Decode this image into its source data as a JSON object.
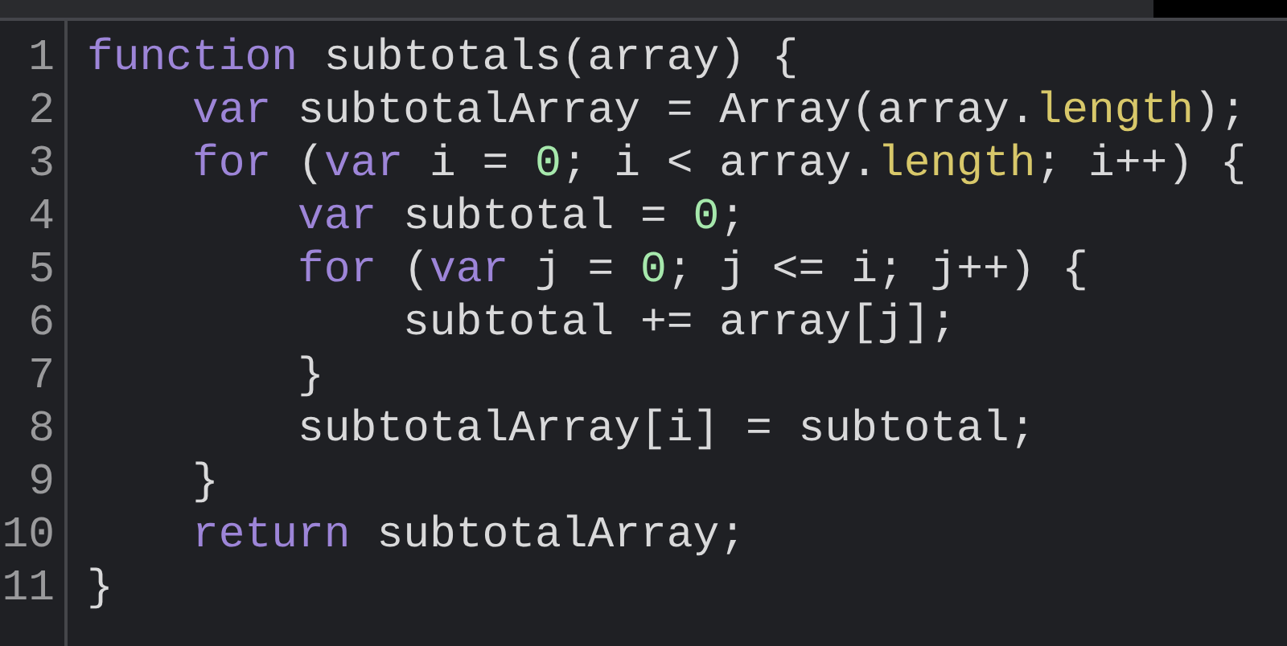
{
  "editor": {
    "lines": [
      {
        "number": "1",
        "tokens": [
          {
            "kind": "keyword",
            "text": "function"
          },
          {
            "kind": "plain",
            "text": " subtotals(array) {"
          }
        ]
      },
      {
        "number": "2",
        "tokens": [
          {
            "kind": "indent"
          },
          {
            "kind": "keyword",
            "text": "var"
          },
          {
            "kind": "plain",
            "text": " subtotalArray = Array(array."
          },
          {
            "kind": "property",
            "text": "length"
          },
          {
            "kind": "plain",
            "text": ");"
          }
        ]
      },
      {
        "number": "3",
        "tokens": [
          {
            "kind": "indent"
          },
          {
            "kind": "keyword",
            "text": "for"
          },
          {
            "kind": "plain",
            "text": " ("
          },
          {
            "kind": "keyword",
            "text": "var"
          },
          {
            "kind": "plain",
            "text": " i = "
          },
          {
            "kind": "number",
            "text": "0"
          },
          {
            "kind": "plain",
            "text": "; i < array."
          },
          {
            "kind": "property",
            "text": "length"
          },
          {
            "kind": "plain",
            "text": "; i++) {"
          }
        ]
      },
      {
        "number": "4",
        "tokens": [
          {
            "kind": "indent"
          },
          {
            "kind": "indent"
          },
          {
            "kind": "keyword",
            "text": "var"
          },
          {
            "kind": "plain",
            "text": " subtotal = "
          },
          {
            "kind": "number",
            "text": "0"
          },
          {
            "kind": "plain",
            "text": ";"
          }
        ]
      },
      {
        "number": "5",
        "tokens": [
          {
            "kind": "indent"
          },
          {
            "kind": "indent"
          },
          {
            "kind": "keyword",
            "text": "for"
          },
          {
            "kind": "plain",
            "text": " ("
          },
          {
            "kind": "keyword",
            "text": "var"
          },
          {
            "kind": "plain",
            "text": " j = "
          },
          {
            "kind": "number",
            "text": "0"
          },
          {
            "kind": "plain",
            "text": "; j <= i; j++) {"
          }
        ]
      },
      {
        "number": "6",
        "tokens": [
          {
            "kind": "indent"
          },
          {
            "kind": "indent"
          },
          {
            "kind": "indent"
          },
          {
            "kind": "plain",
            "text": "subtotal += array[j];"
          }
        ]
      },
      {
        "number": "7",
        "tokens": [
          {
            "kind": "indent"
          },
          {
            "kind": "indent"
          },
          {
            "kind": "plain",
            "text": "}"
          }
        ]
      },
      {
        "number": "8",
        "tokens": [
          {
            "kind": "indent"
          },
          {
            "kind": "indent"
          },
          {
            "kind": "plain",
            "text": "subtotalArray[i] = subtotal;"
          }
        ]
      },
      {
        "number": "9",
        "tokens": [
          {
            "kind": "indent"
          },
          {
            "kind": "plain",
            "text": "}"
          }
        ]
      },
      {
        "number": "10",
        "tokens": [
          {
            "kind": "indent"
          },
          {
            "kind": "keyword",
            "text": "return"
          },
          {
            "kind": "plain",
            "text": " subtotalArray;"
          }
        ]
      },
      {
        "number": "11",
        "tokens": [
          {
            "kind": "plain",
            "text": "}"
          }
        ]
      }
    ]
  }
}
